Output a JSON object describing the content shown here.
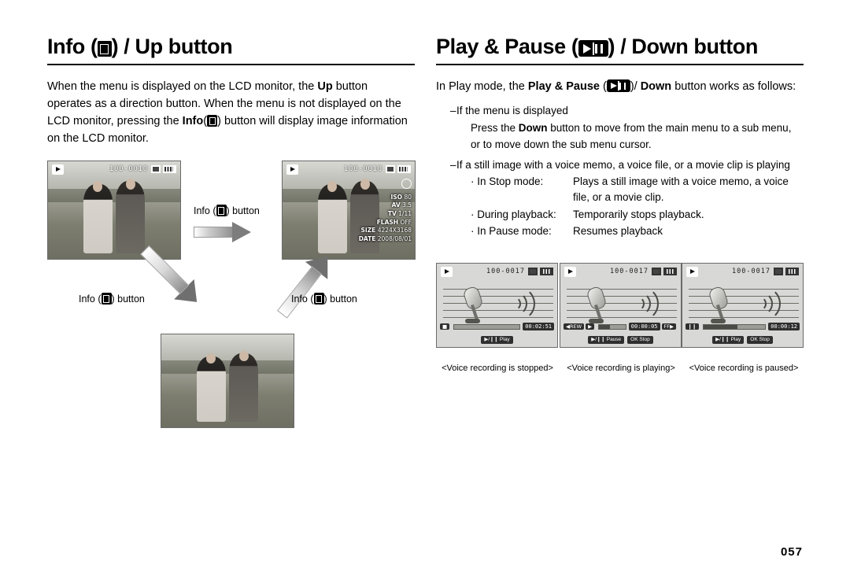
{
  "left": {
    "title_before": "Info (",
    "title_after": ") / Up button",
    "paragraph_1": "When the menu is displayed on the LCD monitor, the ",
    "paragraph_bold_up": "Up",
    "paragraph_2": " button operates as a direction button. When the menu is not displayed on the LCD monitor, pressing the ",
    "paragraph_bold_info": "Info",
    "paragraph_3": "(",
    "paragraph_4": ") button will display image information on the LCD monitor.",
    "photo_top_counter": "100-0010",
    "caption_right_of_arrow": "button",
    "caption_info": "Info (",
    "caption_close": ") button",
    "osd": {
      "iso_key": "ISO",
      "iso_value": "80",
      "av_key": "AV",
      "av_value": "3.5",
      "tv_key": "TV",
      "tv_value": "1/11",
      "flash_key": "FLASH",
      "flash_value": "OFF",
      "size_key": "SIZE",
      "size_value": "4224X3168",
      "date_key": "DATE",
      "date_value": "2008/08/01"
    }
  },
  "right": {
    "title_before": "Play & Pause (",
    "title_after": ") / Down button",
    "intro_1": "In Play mode, the ",
    "intro_bold": "Play & Pause",
    "intro_2": " (",
    "intro_3": ")/ ",
    "intro_bold2": "Down",
    "intro_4": "  button works as follows:",
    "bullet_1": "If the menu is displayed",
    "bullet_1_body_a": "Press the ",
    "bullet_1_body_bold": "Down",
    "bullet_1_body_b": " button to move from the main menu to a sub menu, or to move down the sub menu cursor.",
    "bullet_2": "If a still image with a voice memo, a voice file, or a movie clip is playing",
    "modes": [
      {
        "label": "· In Stop mode:",
        "desc": "Plays a still image with a voice memo, a voice file, or a movie clip."
      },
      {
        "label": "· During playback:",
        "desc": "Temporarily stops playback."
      },
      {
        "label": "· In Pause mode:",
        "desc": "Resumes playback"
      }
    ],
    "panels": [
      {
        "counter": "100-0017",
        "left_chip": "stop-square",
        "time": "00:02:51",
        "bottom_buttons": [
          "play-pause-play"
        ],
        "bottom_label": "Play",
        "ok_label": "",
        "stop_label": "",
        "caption": "<Voice recording is stopped>",
        "progress": 0
      },
      {
        "counter": "100-0017",
        "left_chip": "REW",
        "time": "00:00:05",
        "right_chip": "FF",
        "bottom_label": "Pause",
        "ok_label": "OK",
        "stop_label": "Stop",
        "caption": "<Voice recording is playing>",
        "progress": 40
      },
      {
        "counter": "100-0017",
        "left_chip": "pause",
        "time": "00:00:12",
        "bottom_label": "Play",
        "ok_label": "OK",
        "stop_label": "Stop",
        "caption": "<Voice recording is paused>",
        "progress": 55
      }
    ]
  },
  "page_number": "057"
}
